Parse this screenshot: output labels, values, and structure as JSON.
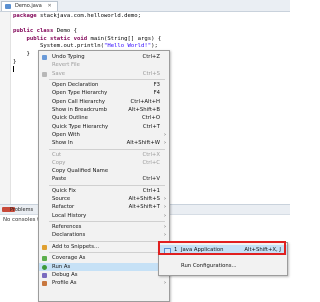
{
  "editor": {
    "tab_label": "Demo.java",
    "lines": {
      "l1_kw": "package",
      "l1_rest": " stackjava.com.helloworld.demo;",
      "l3_kw": "public class",
      "l3_rest": " Demo {",
      "l4_kw": "public static void",
      "l4_rest": " main(String[] args) {",
      "l5_pre": "System.out.println(",
      "l5_str": "\"Hello World!\"",
      "l5_post": ");",
      "l6": "}",
      "l7": "}"
    }
  },
  "panel": {
    "tab_label": "Problems",
    "message": "No consoles to"
  },
  "menu": {
    "undo": {
      "label": "Undo Typing",
      "sc": "Ctrl+Z"
    },
    "revert": {
      "label": "Revert File",
      "sc": ""
    },
    "save": {
      "label": "Save",
      "sc": "Ctrl+S"
    },
    "open_decl": {
      "label": "Open Declaration",
      "sc": "F3"
    },
    "open_type_hier": {
      "label": "Open Type Hierarchy",
      "sc": "F4"
    },
    "open_call_hier": {
      "label": "Open Call Hierarchy",
      "sc": "Ctrl+Alt+H"
    },
    "breadcrumb": {
      "label": "Show in Breadcrumb",
      "sc": "Alt+Shift+B"
    },
    "quick_outline": {
      "label": "Quick Outline",
      "sc": "Ctrl+O"
    },
    "quick_type_hier": {
      "label": "Quick Type Hierarchy",
      "sc": "Ctrl+T"
    },
    "open_with": {
      "label": "Open With",
      "sc": ""
    },
    "show_in": {
      "label": "Show In",
      "sc": "Alt+Shift+W"
    },
    "cut": {
      "label": "Cut",
      "sc": "Ctrl+X"
    },
    "copy": {
      "label": "Copy",
      "sc": "Ctrl+C"
    },
    "copy_qn": {
      "label": "Copy Qualified Name",
      "sc": ""
    },
    "paste": {
      "label": "Paste",
      "sc": "Ctrl+V"
    },
    "quick_fix": {
      "label": "Quick Fix",
      "sc": "Ctrl+1"
    },
    "source": {
      "label": "Source",
      "sc": "Alt+Shift+S"
    },
    "refactor": {
      "label": "Refactor",
      "sc": "Alt+Shift+T"
    },
    "local_history": {
      "label": "Local History",
      "sc": ""
    },
    "references": {
      "label": "References",
      "sc": ""
    },
    "declarations": {
      "label": "Declarations",
      "sc": ""
    },
    "snippets": {
      "label": "Add to Snippets...",
      "sc": ""
    },
    "coverage": {
      "label": "Coverage As",
      "sc": ""
    },
    "run_as": {
      "label": "Run As",
      "sc": ""
    },
    "debug_as": {
      "label": "Debug As",
      "sc": ""
    },
    "profile_as": {
      "label": "Profile As",
      "sc": ""
    }
  },
  "submenu": {
    "java_app": {
      "num": "1",
      "label": "Java Application",
      "sc": "Alt+Shift+X, J"
    },
    "run_config": {
      "label": "Run Configurations..."
    }
  }
}
